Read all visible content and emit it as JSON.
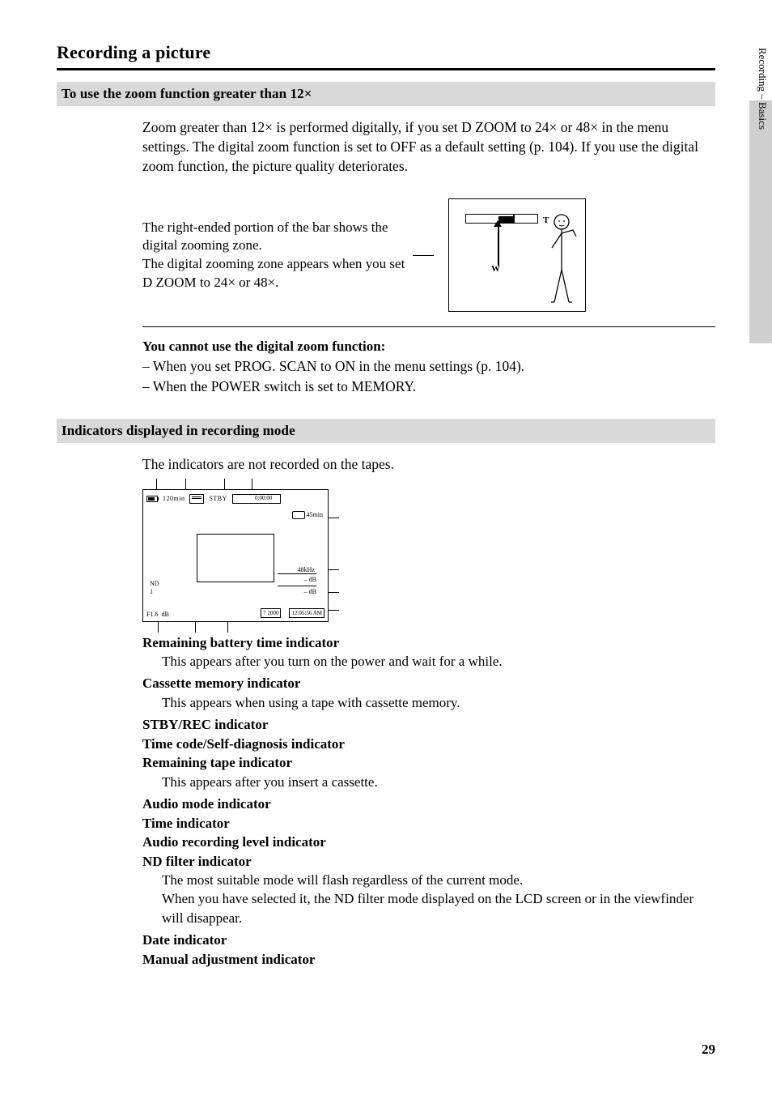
{
  "page": {
    "title": "Recording a picture",
    "number": "29"
  },
  "side_tab": "Recording – Basics",
  "sec_zoom": {
    "heading": "To use the zoom function greater than 12×",
    "p1_a": "Zoom greater than ",
    "p1_b": "12×",
    "p1_c": " is performed digitally, if you set D ZOOM to ",
    "p1_d": "24×",
    "p1_e": " or ",
    "p1_f": "48×",
    "p1_g": " in the menu settings. The digital zoom function is set to OFF as a default setting (p. 104). If you use the digital zoom function, the picture quality deteriorates.",
    "caption_a": "The right-ended portion of the bar shows the digital zooming zone.",
    "caption_b": "The digital zooming zone appears when you set D ZOOM to ",
    "caption_c": "24×",
    "caption_d": " or ",
    "caption_e": "48×",
    "caption_f": ".",
    "W": "W",
    "T": "T",
    "notes_title": "You cannot use the digital zoom function:",
    "note1": "– When you set PROG. SCAN to ON in the menu settings (p. 104).",
    "note2": "– When the POWER switch is set to MEMORY."
  },
  "sec_ind": {
    "heading": "Indicators displayed in recording mode",
    "intro": "The indicators are not recorded on the tapes.",
    "osd": {
      "batt": "120min",
      "stby": "STBY",
      "tc": "0:00:00",
      "rem_label": "45min",
      "center_label": "48kHz",
      "date": " 7 2000",
      "time": "12:05:56 AM",
      "audio1": "–      dB",
      "audio2": "–      dB",
      "nd1": "ND",
      "nd2": "1",
      "f": "F1.6",
      "db": "dB"
    }
  },
  "legend": {
    "i1_t": "Remaining battery time indicator",
    "i1_d": "This appears after you turn on the power and wait for a while.",
    "i2_t": "Cassette memory indicator",
    "i2_d": "This appears when using a tape with cassette memory.",
    "i3_t": "STBY/REC indicator",
    "i4_t": "Time code/Self-diagnosis indicator",
    "i5_t": "Remaining tape indicator",
    "i5_d": "This appears after you insert a cassette.",
    "i6_t": "Audio mode indicator",
    "i7_t": "Time indicator",
    "i8_t": "Audio recording level indicator",
    "i9_t": "ND filter indicator",
    "i9_d1": "The most suitable mode will flash regardless of the current mode.",
    "i9_d2": "When you have selected it, the ND filter mode displayed on the LCD screen or in the viewfinder will disappear.",
    "i10_t": "Date indicator",
    "i11_t": "Manual adjustment indicator"
  }
}
